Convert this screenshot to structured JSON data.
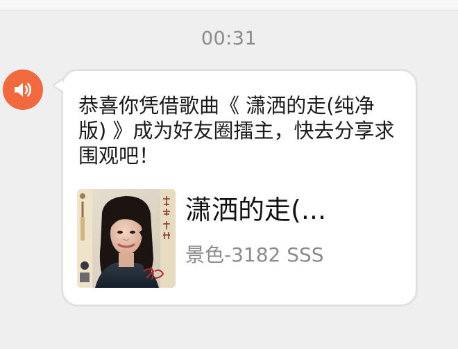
{
  "timestamp": "00:31",
  "avatar": {
    "icon": "speaker-icon",
    "color": "#f1693d"
  },
  "message": {
    "text": "恭喜你凭借歌曲《 潇洒的走(纯净版) 》成为好友圈擂主，快去分享求围观吧！"
  },
  "song_card": {
    "title": "潇洒的走(...",
    "subtitle": "景色-3182 SSS"
  }
}
